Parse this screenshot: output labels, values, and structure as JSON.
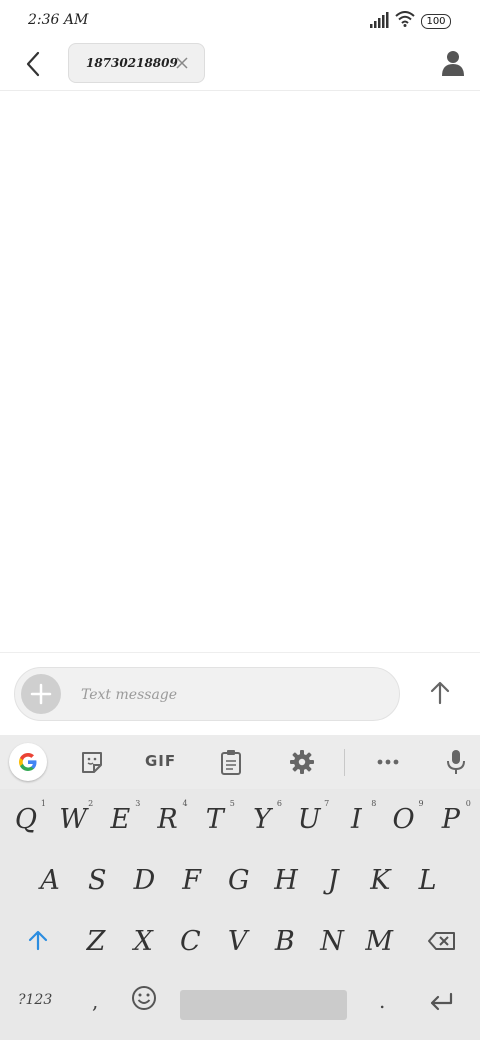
{
  "status_bar": {
    "time": "2:36 AM",
    "battery": "100"
  },
  "header": {
    "recipient": "18730218809"
  },
  "compose": {
    "placeholder": "Text message"
  },
  "keyboard": {
    "gif_label": "GIF",
    "symbols_label": "?123",
    "comma": ",",
    "period": ".",
    "row1": [
      "Q",
      "W",
      "E",
      "R",
      "T",
      "Y",
      "U",
      "I",
      "O",
      "P"
    ],
    "row1_hints": [
      "1",
      "2",
      "3",
      "4",
      "5",
      "6",
      "7",
      "8",
      "9",
      "0"
    ],
    "row2": [
      "A",
      "S",
      "D",
      "F",
      "G",
      "H",
      "J",
      "K",
      "L"
    ],
    "row3": [
      "Z",
      "X",
      "C",
      "V",
      "B",
      "N",
      "M"
    ]
  },
  "colors": {
    "accent_shift": "#2b8de0",
    "icon_gray": "#666666"
  }
}
